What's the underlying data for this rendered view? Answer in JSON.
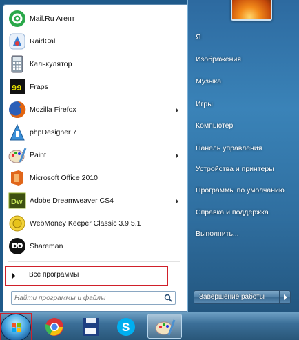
{
  "programs": [
    {
      "label": "Mail.Ru Агент",
      "icon": "mailru-agent-icon",
      "submenu": false,
      "color": "#2aa84a"
    },
    {
      "label": "RaidCall",
      "icon": "raidcall-icon",
      "submenu": false,
      "color": "#3a7fd0"
    },
    {
      "label": "Калькулятор",
      "icon": "calculator-icon",
      "submenu": false,
      "color": "#8a9aa8"
    },
    {
      "label": "Fraps",
      "icon": "fraps-icon",
      "submenu": false,
      "color": "#d8d000"
    },
    {
      "label": "Mozilla Firefox",
      "icon": "firefox-icon",
      "submenu": true,
      "color": "#e3650f"
    },
    {
      "label": "phpDesigner 7",
      "icon": "phpdesigner-icon",
      "submenu": false,
      "color": "#3a8fd8"
    },
    {
      "label": "Paint",
      "icon": "paint-icon",
      "submenu": true,
      "color": "#4a8fcf"
    },
    {
      "label": "Microsoft Office 2010",
      "icon": "ms-office-icon",
      "submenu": false,
      "color": "#e0661a"
    },
    {
      "label": "Adobe Dreamweaver CS4",
      "icon": "dreamweaver-icon",
      "submenu": true,
      "color": "#6f8a1f",
      "icon_text": "Dw"
    },
    {
      "label": "WebMoney Keeper Classic 3.9.5.1",
      "icon": "webmoney-icon",
      "submenu": false,
      "color": "#e7c31a"
    },
    {
      "label": "Shareman",
      "icon": "shareman-icon",
      "submenu": false,
      "color": "#111111"
    }
  ],
  "all_programs_label": "Все программы",
  "search": {
    "placeholder": "Найти программы и файлы"
  },
  "right_items": [
    "Я",
    "Изображения",
    "Музыка",
    "Игры",
    "Компьютер",
    "Панель управления",
    "Устройства и принтеры",
    "Программы по умолчанию",
    "Справка и поддержка",
    "Выполнить..."
  ],
  "shutdown_label": "Завершение работы",
  "taskbar": {
    "items": [
      {
        "icon": "chrome-icon"
      },
      {
        "icon": "save-floppy-icon"
      },
      {
        "icon": "skype-icon"
      },
      {
        "icon": "paint-icon",
        "active": true
      }
    ]
  },
  "highlight_color": "#d0202a"
}
